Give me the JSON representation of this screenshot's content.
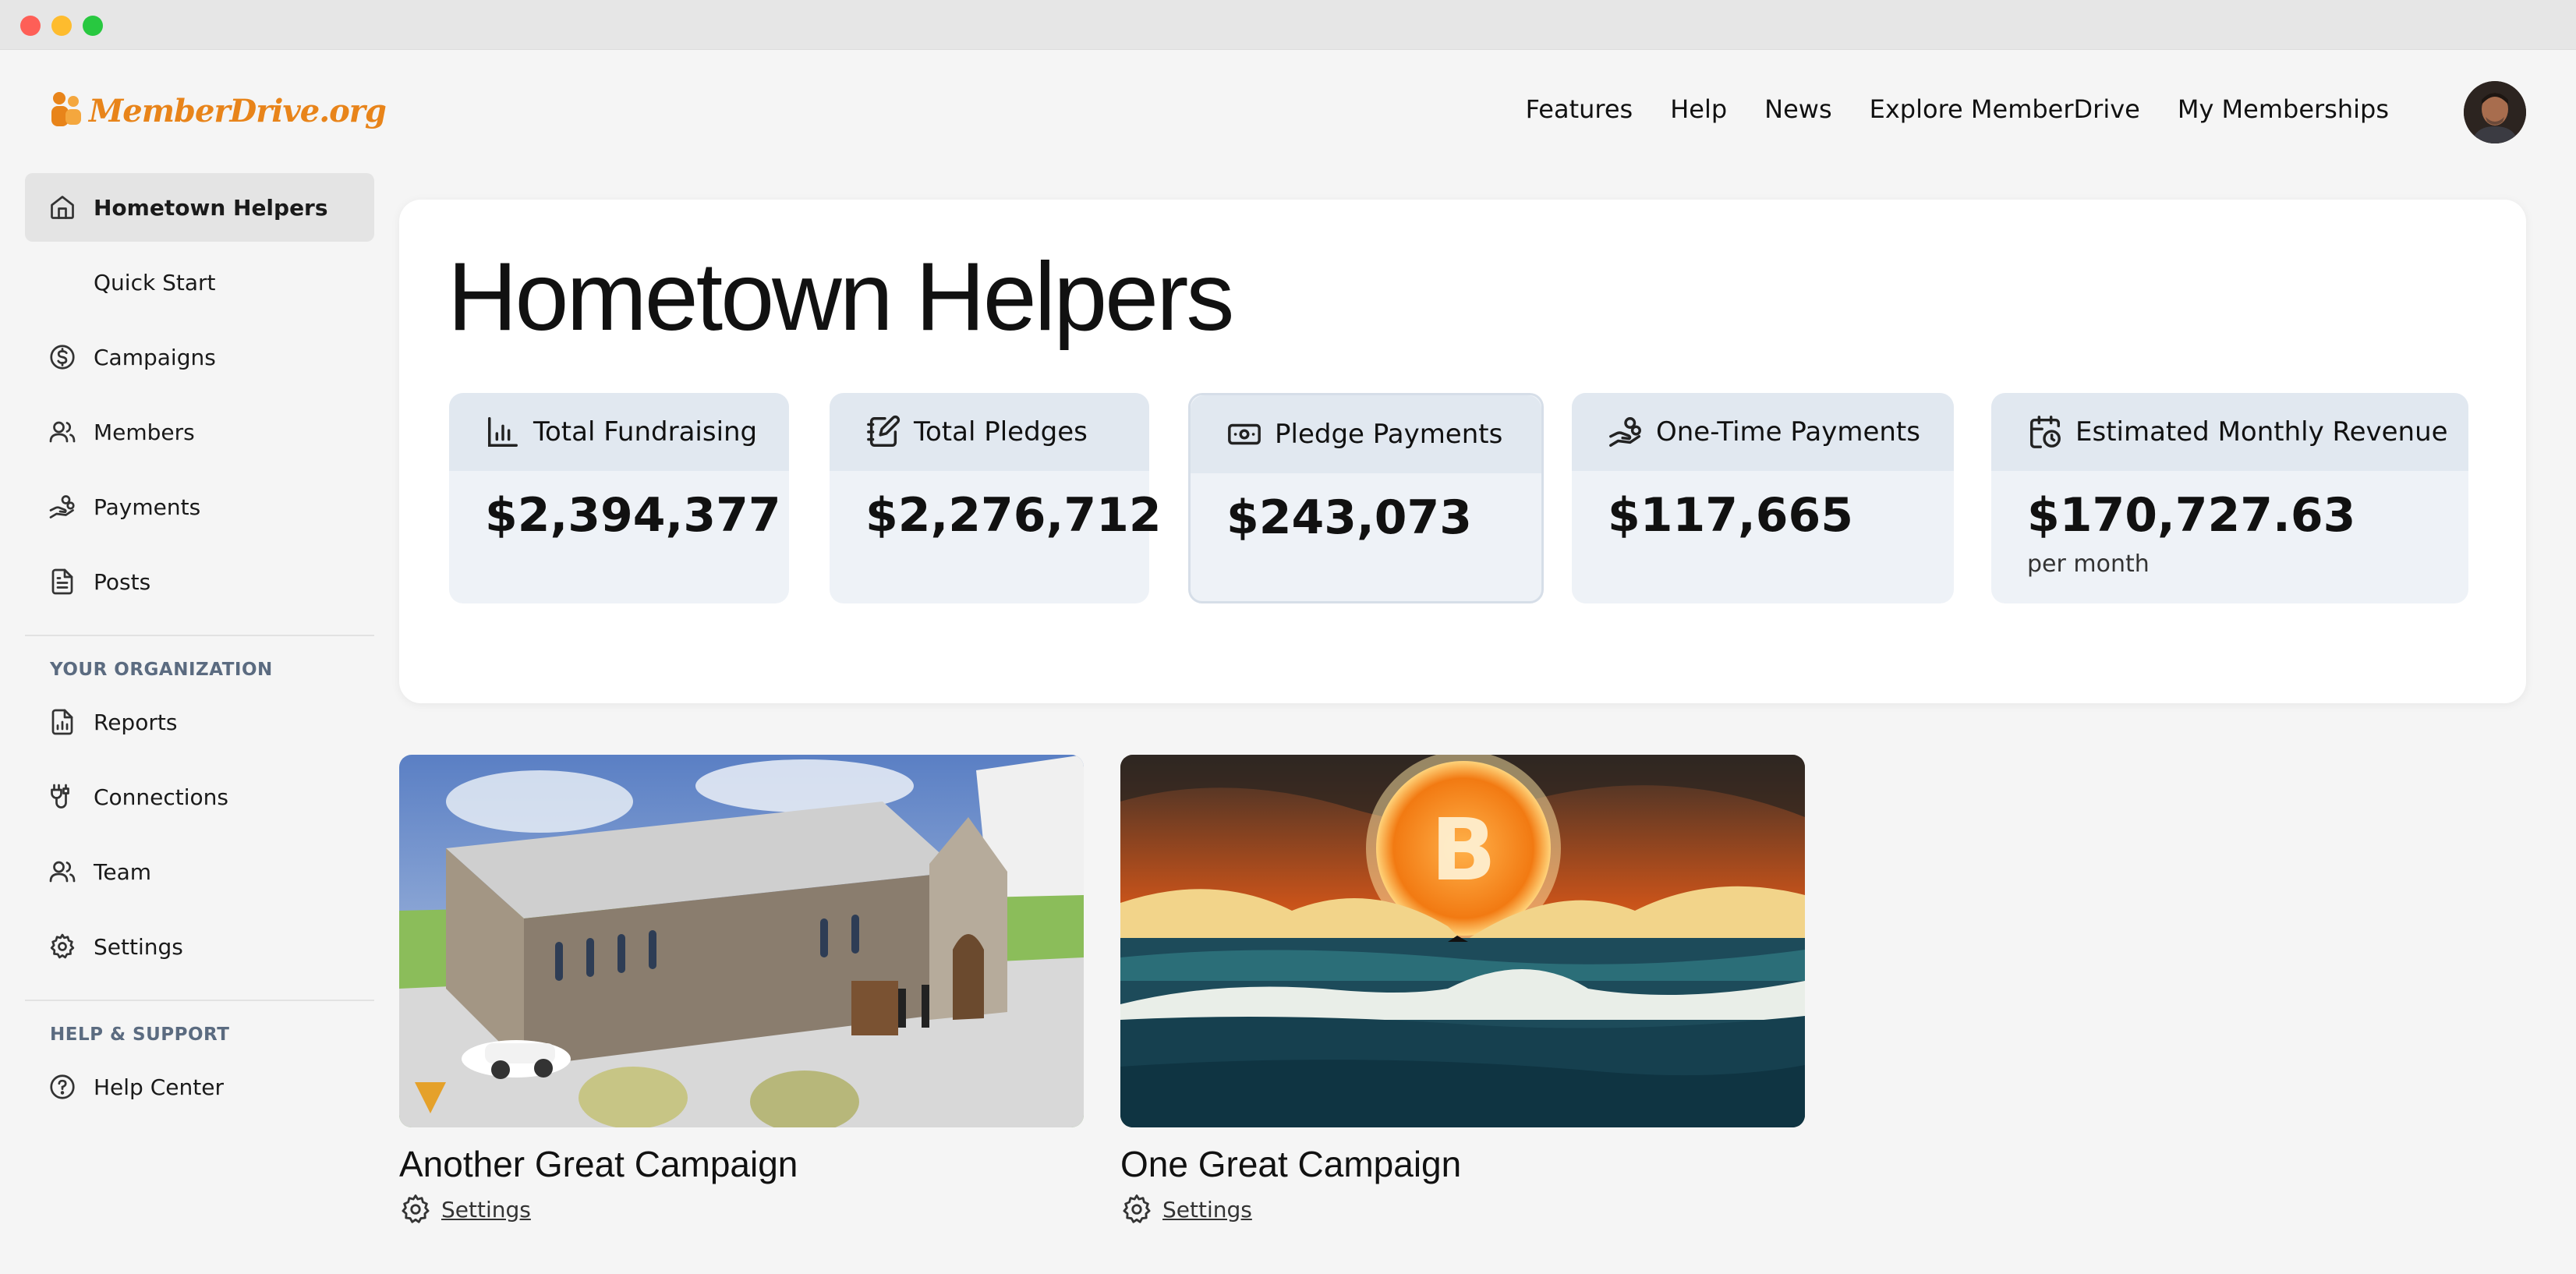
{
  "app": {
    "logo_text": "MemberDrive.org",
    "accent": "#e8841a"
  },
  "topnav": {
    "items": [
      "Features",
      "Help",
      "News",
      "Explore MemberDrive",
      "My Memberships"
    ]
  },
  "sidebar": {
    "items": [
      {
        "label": "Hometown Helpers",
        "icon": "home-icon"
      },
      {
        "label": "Quick Start",
        "icon": ""
      },
      {
        "label": "Campaigns",
        "icon": "dollar-circle-icon"
      },
      {
        "label": "Members",
        "icon": "users-icon"
      },
      {
        "label": "Payments",
        "icon": "hand-coins-icon"
      },
      {
        "label": "Posts",
        "icon": "document-icon"
      }
    ],
    "org_section": "YOUR ORGANIZATION",
    "org_items": [
      {
        "label": "Reports",
        "icon": "report-icon"
      },
      {
        "label": "Connections",
        "icon": "plug-icon"
      },
      {
        "label": "Team",
        "icon": "users-icon"
      },
      {
        "label": "Settings",
        "icon": "gear-icon"
      }
    ],
    "help_section": "HELP & SUPPORT",
    "help_items": [
      {
        "label": "Help Center",
        "icon": "help-circle-icon"
      }
    ]
  },
  "main": {
    "title": "Hometown Helpers",
    "stats": [
      {
        "label": "Total Fundraising",
        "value": "$2,394,377",
        "icon": "bar-chart-icon"
      },
      {
        "label": "Total Pledges",
        "value": "$2,276,712",
        "icon": "notebook-pen-icon"
      },
      {
        "label": "Pledge Payments",
        "value": "$243,073",
        "icon": "banknote-icon"
      },
      {
        "label": "One-Time Payments",
        "value": "$117,665",
        "icon": "hand-coins-icon"
      },
      {
        "label": "Estimated Monthly Revenue",
        "value": "$170,727.63",
        "sub": "per month",
        "icon": "calendar-clock-icon"
      }
    ]
  },
  "campaigns": [
    {
      "title": "Another Great Campaign",
      "settings_label": "Settings"
    },
    {
      "title": "One Great Campaign",
      "settings_label": "Settings"
    }
  ]
}
